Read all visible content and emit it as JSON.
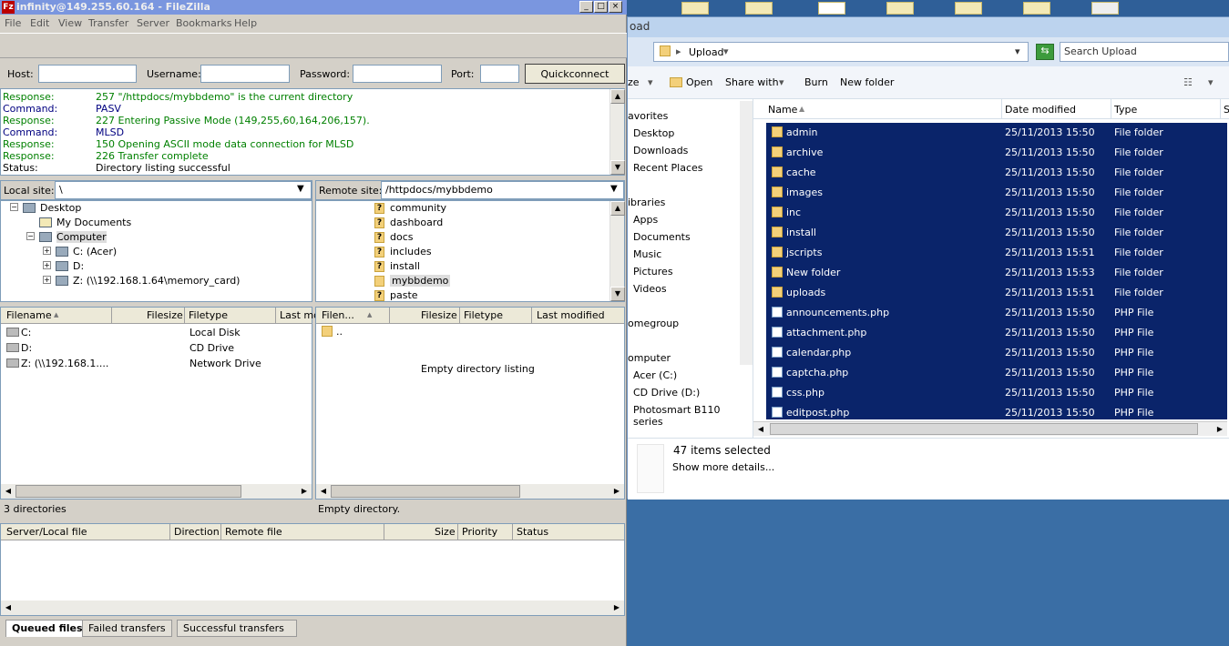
{
  "explorer": {
    "title_fragment": "oad",
    "address": "Upload",
    "search_placeholder": "Search Upload",
    "toolbar": [
      "ze",
      "Open",
      "Share with",
      "Burn",
      "New folder"
    ],
    "nav_items": [
      "avorites",
      "Desktop",
      "Downloads",
      "Recent Places",
      "ibraries",
      "Apps",
      "Documents",
      "Music",
      "Pictures",
      "Videos",
      "omegroup",
      "omputer",
      "Acer (C:)",
      "CD Drive (D:)",
      "Photosmart B110 series"
    ],
    "columns": [
      "Name",
      "Date modified",
      "Type",
      "S"
    ],
    "rows": [
      {
        "name": "admin",
        "date": "25/11/2013 15:50",
        "type": "File folder",
        "kind": "folder"
      },
      {
        "name": "archive",
        "date": "25/11/2013 15:50",
        "type": "File folder",
        "kind": "folder"
      },
      {
        "name": "cache",
        "date": "25/11/2013 15:50",
        "type": "File folder",
        "kind": "folder"
      },
      {
        "name": "images",
        "date": "25/11/2013 15:50",
        "type": "File folder",
        "kind": "folder"
      },
      {
        "name": "inc",
        "date": "25/11/2013 15:50",
        "type": "File folder",
        "kind": "folder"
      },
      {
        "name": "install",
        "date": "25/11/2013 15:50",
        "type": "File folder",
        "kind": "folder"
      },
      {
        "name": "jscripts",
        "date": "25/11/2013 15:51",
        "type": "File folder",
        "kind": "folder"
      },
      {
        "name": "New folder",
        "date": "25/11/2013 15:53",
        "type": "File folder",
        "kind": "folder"
      },
      {
        "name": "uploads",
        "date": "25/11/2013 15:51",
        "type": "File folder",
        "kind": "folder"
      },
      {
        "name": "announcements.php",
        "date": "25/11/2013 15:50",
        "type": "PHP File",
        "kind": "php"
      },
      {
        "name": "attachment.php",
        "date": "25/11/2013 15:50",
        "type": "PHP File",
        "kind": "php"
      },
      {
        "name": "calendar.php",
        "date": "25/11/2013 15:50",
        "type": "PHP File",
        "kind": "php"
      },
      {
        "name": "captcha.php",
        "date": "25/11/2013 15:50",
        "type": "PHP File",
        "kind": "php"
      },
      {
        "name": "css.php",
        "date": "25/11/2013 15:50",
        "type": "PHP File",
        "kind": "php"
      },
      {
        "name": "editpost.php",
        "date": "25/11/2013 15:50",
        "type": "PHP File",
        "kind": "php"
      }
    ],
    "selection_count": "47 items selected",
    "details_link": "Show more details..."
  },
  "filezilla": {
    "title": "infinity@149.255.60.164 - FileZilla",
    "menu": [
      "File",
      "Edit",
      "View",
      "Transfer",
      "Server",
      "Bookmarks",
      "Help"
    ],
    "quickconnect": {
      "host_label": "Host:",
      "user_label": "Username:",
      "pass_label": "Password:",
      "port_label": "Port:",
      "button": "Quickconnect"
    },
    "log": [
      {
        "k": "Response:",
        "v": "257 \"/httpdocs/mybbdemo\" is the current directory",
        "color": "#008000"
      },
      {
        "k": "Command:",
        "v": "PASV",
        "color": "#000080"
      },
      {
        "k": "Response:",
        "v": "227 Entering Passive Mode (149,255,60,164,206,157).",
        "color": "#008000"
      },
      {
        "k": "Command:",
        "v": "MLSD",
        "color": "#000080"
      },
      {
        "k": "Response:",
        "v": "150 Opening ASCII mode data connection for MLSD",
        "color": "#008000"
      },
      {
        "k": "Response:",
        "v": "226 Transfer complete",
        "color": "#008000"
      },
      {
        "k": "Status:",
        "v": "Directory listing successful",
        "color": "#000000"
      }
    ],
    "local": {
      "label": "Local site:",
      "path": "\\",
      "tree": [
        {
          "text": "Desktop",
          "indent": 0,
          "exp": "−"
        },
        {
          "text": "My Documents",
          "indent": 1,
          "exp": ""
        },
        {
          "text": "Computer",
          "indent": 1,
          "exp": "−"
        },
        {
          "text": "C: (Acer)",
          "indent": 2,
          "exp": "+"
        },
        {
          "text": "D:",
          "indent": 2,
          "exp": "+"
        },
        {
          "text": "Z: (\\\\192.168.1.64\\memory_card)",
          "indent": 2,
          "exp": "+"
        }
      ],
      "columns": [
        "Filename",
        "Filesize",
        "Filetype",
        "Last mo"
      ],
      "files": [
        {
          "name": "C:",
          "type": "Local Disk"
        },
        {
          "name": "D:",
          "type": "CD Drive"
        },
        {
          "name": "Z: (\\\\192.168.1....",
          "type": "Network Drive"
        }
      ],
      "status": "3 directories"
    },
    "remote": {
      "label": "Remote site:",
      "path": "/httpdocs/mybbdemo",
      "tree": [
        "community",
        "dashboard",
        "docs",
        "includes",
        "install",
        "mybbdemo",
        "paste"
      ],
      "columns": [
        "Filen...",
        "Filesize",
        "Filetype",
        "Last modified"
      ],
      "parent": "..",
      "empty": "Empty directory listing",
      "status": "Empty directory."
    },
    "queue": {
      "columns": [
        "Server/Local file",
        "Direction",
        "Remote file",
        "Size",
        "Priority",
        "Status"
      ],
      "tabs": [
        "Queued files",
        "Failed transfers",
        "Successful transfers"
      ]
    }
  }
}
